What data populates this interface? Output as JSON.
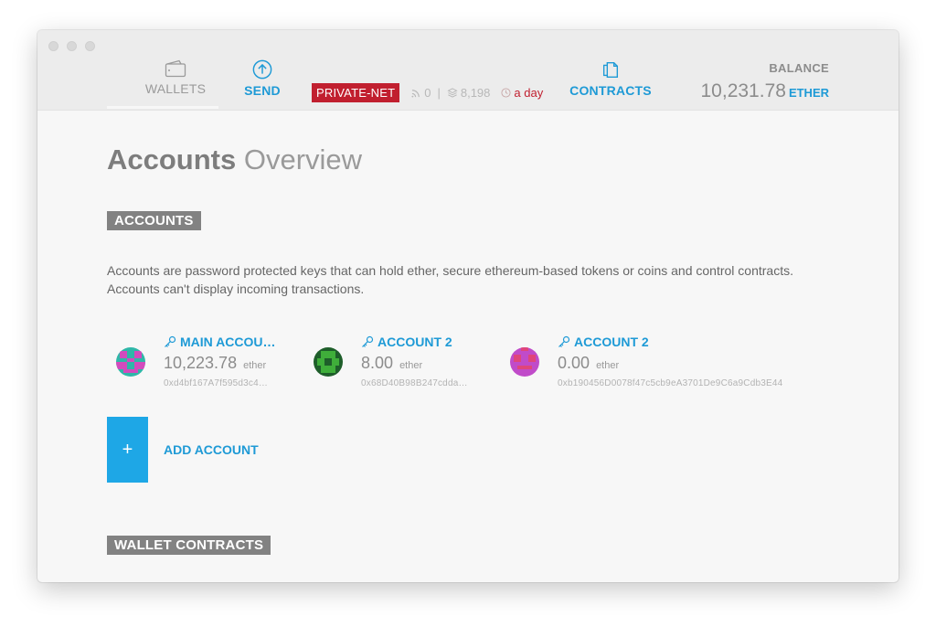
{
  "nav": {
    "wallets_label": "WALLETS",
    "send_label": "SEND",
    "contracts_label": "CONTRACTS"
  },
  "status": {
    "network": "PRIVATE-NET",
    "peers": "0",
    "separator": "|",
    "blocks": "8,198",
    "last_block": "a day"
  },
  "balance": {
    "title": "BALANCE",
    "value": "10,231.78",
    "unit": "ETHER"
  },
  "page": {
    "title_strong": "Accounts",
    "title_light": " Overview"
  },
  "accounts_section": {
    "badge": "ACCOUNTS",
    "description_line1": "Accounts are password protected keys that can hold ether, secure ethereum-based tokens or coins and control contracts.",
    "description_line2": "Accounts can't display incoming transactions.",
    "items": [
      {
        "name": "MAIN ACCOU…",
        "balance": "10,223.78",
        "unit": "ether",
        "address": "0xd4bf167A7f595d3c4…",
        "avatar_color": "#2fb7a8",
        "avatar_accent": "#d34bbd"
      },
      {
        "name": "ACCOUNT 2",
        "balance": "8.00",
        "unit": "ether",
        "address": "0x68D40B98B247cdda…",
        "avatar_color": "#1e5e2a",
        "avatar_accent": "#3fae3a"
      },
      {
        "name": "ACCOUNT 2",
        "balance": "0.00",
        "unit": "ether",
        "address": "0xb190456D0078f47c5cb9eA3701De9C6a9Cdb3E44",
        "avatar_color": "#c04bc9",
        "avatar_accent": "#e0457a"
      }
    ],
    "add_icon": "+",
    "add_label": "ADD ACCOUNT"
  },
  "wallet_section": {
    "badge": "WALLET CONTRACTS"
  },
  "icons": {
    "wallets": "wallet-icon",
    "send": "arrow-up-circle-icon",
    "contracts": "documents-icon",
    "peers": "signal-icon",
    "blocks": "layers-icon",
    "time": "clock-icon",
    "key": "key-icon"
  },
  "colors": {
    "accent": "#1e9ad6",
    "private_net": "#c11f2f",
    "add_button": "#1ea7e6",
    "badge_gray": "#828282"
  }
}
